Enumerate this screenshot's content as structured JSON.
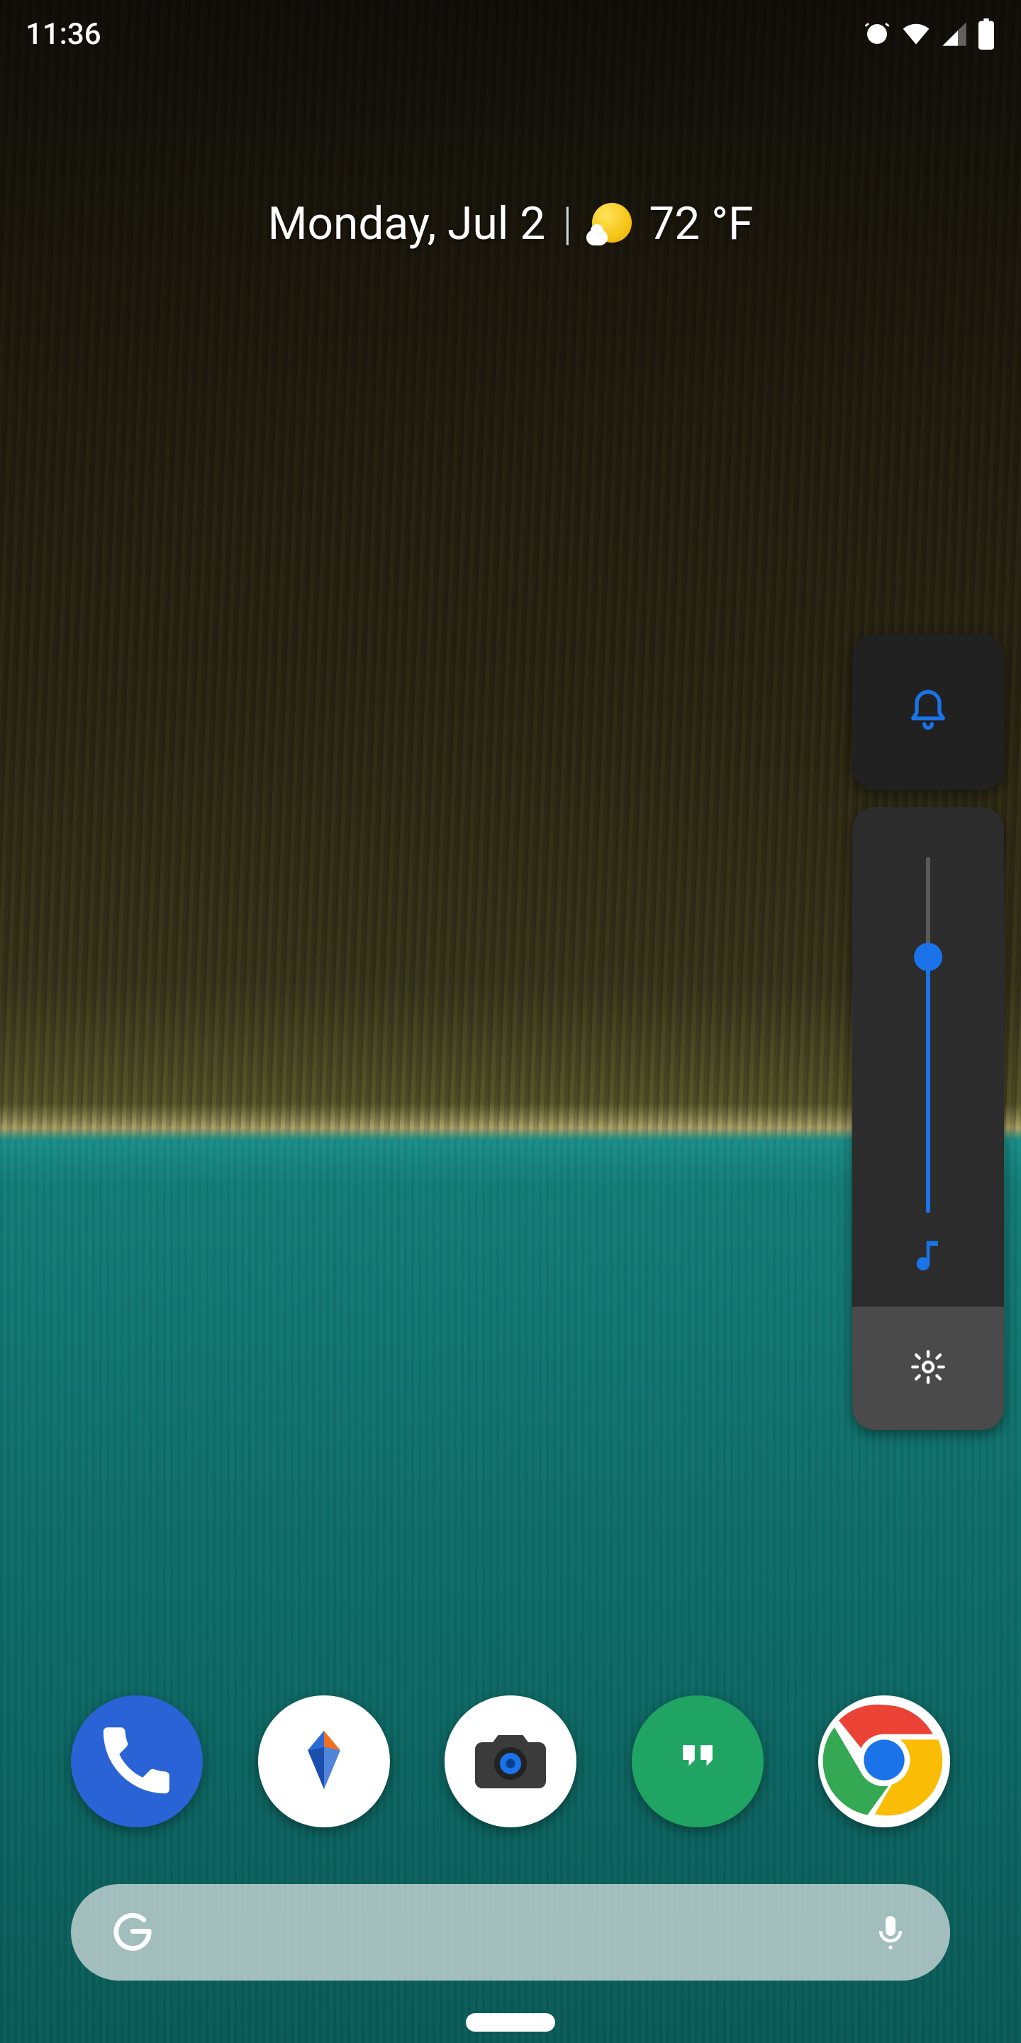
{
  "status_bar": {
    "time": "11:36",
    "icons": [
      "alarm-icon",
      "wifi-icon",
      "cell-signal-icon",
      "battery-icon"
    ]
  },
  "glance": {
    "date": "Monday, Jul 2",
    "separator": "|",
    "temperature": "72 °F",
    "weather_icon": "partly-sunny-icon"
  },
  "volume_panel": {
    "ringer_mode_icon": "bell-icon",
    "accent_color": "#1a73e8",
    "slider": {
      "value": 72,
      "min": 0,
      "max": 100,
      "stream_icon": "music-note-icon"
    },
    "settings_icon": "gear-icon"
  },
  "dock": {
    "apps": [
      {
        "name": "Phone",
        "icon": "phone-icon",
        "bg": "#2a63d6"
      },
      {
        "name": "Wallet",
        "icon": "diamond-icon",
        "bg": "#ffffff"
      },
      {
        "name": "Camera",
        "icon": "camera-icon",
        "bg": "#ffffff"
      },
      {
        "name": "Hangouts",
        "icon": "hangouts-icon",
        "bg": "#1fa463"
      },
      {
        "name": "Chrome",
        "icon": "chrome-icon",
        "bg": "#ffffff"
      }
    ]
  },
  "search": {
    "logo_icon": "google-g-icon",
    "mic_icon": "microphone-icon"
  },
  "navigation": {
    "gesture_pill": true
  }
}
